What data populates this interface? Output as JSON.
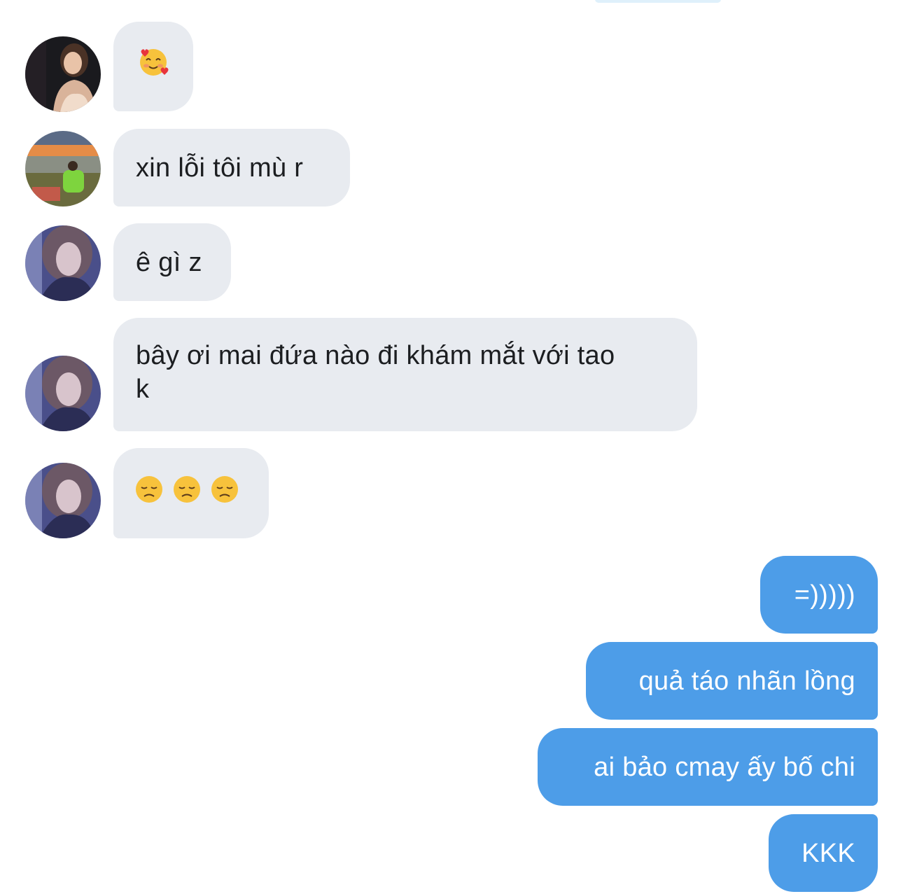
{
  "conversation": {
    "incoming": [
      {
        "text": "",
        "emoji": [
          "smiling-face-with-hearts-icon"
        ]
      },
      {
        "text": "xin lỗi tôi mù r"
      },
      {
        "text": "ê gì z"
      },
      {
        "text_line1": "bây ơi mai đứa nào đi khám mắt với tao",
        "text_line2": "k"
      },
      {
        "text": "",
        "emoji": [
          "disappointed-face-icon",
          "disappointed-face-icon",
          "disappointed-face-icon"
        ]
      }
    ],
    "outgoing": [
      {
        "text": "=)))))"
      },
      {
        "text": "quả táo nhãn lồng"
      },
      {
        "text": "ai bảo cmay ấy bố chi"
      },
      {
        "text": "KKK"
      }
    ]
  },
  "colors": {
    "incoming_bubble": "#e8ebf0",
    "outgoing_bubble": "#4d9de8",
    "incoming_text": "#1c1e21",
    "outgoing_text": "#ffffff"
  }
}
